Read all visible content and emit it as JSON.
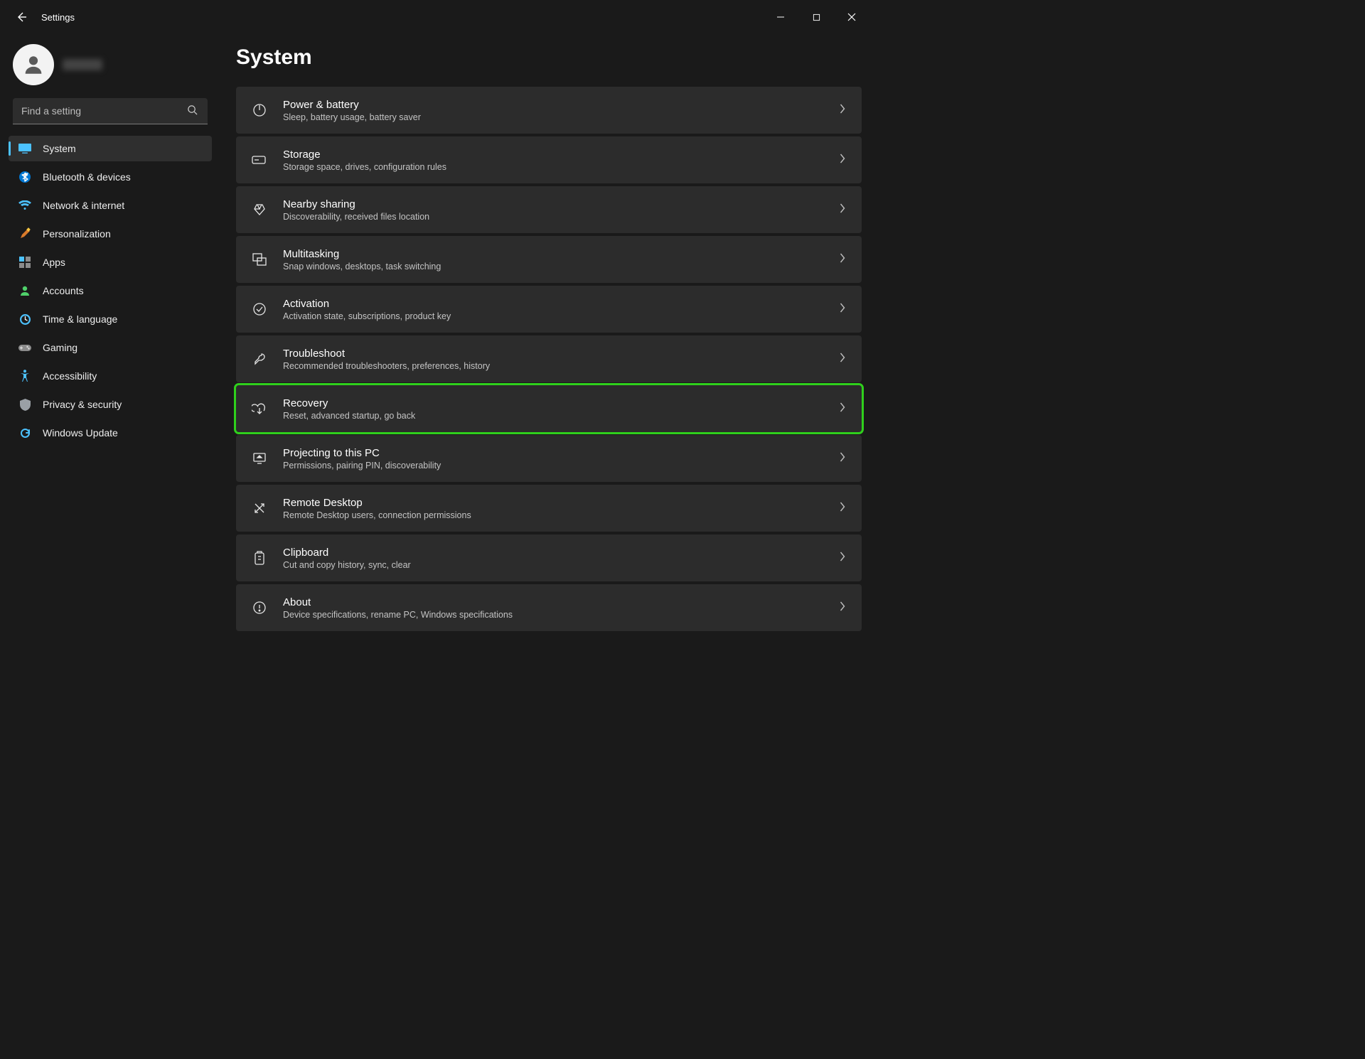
{
  "titlebar": {
    "app_title": "Settings"
  },
  "search": {
    "placeholder": "Find a setting"
  },
  "page": {
    "title": "System"
  },
  "sidebar": {
    "items": [
      {
        "label": "System"
      },
      {
        "label": "Bluetooth & devices"
      },
      {
        "label": "Network & internet"
      },
      {
        "label": "Personalization"
      },
      {
        "label": "Apps"
      },
      {
        "label": "Accounts"
      },
      {
        "label": "Time & language"
      },
      {
        "label": "Gaming"
      },
      {
        "label": "Accessibility"
      },
      {
        "label": "Privacy & security"
      },
      {
        "label": "Windows Update"
      }
    ]
  },
  "cards": [
    {
      "title": "Power & battery",
      "sub": "Sleep, battery usage, battery saver"
    },
    {
      "title": "Storage",
      "sub": "Storage space, drives, configuration rules"
    },
    {
      "title": "Nearby sharing",
      "sub": "Discoverability, received files location"
    },
    {
      "title": "Multitasking",
      "sub": "Snap windows, desktops, task switching"
    },
    {
      "title": "Activation",
      "sub": "Activation state, subscriptions, product key"
    },
    {
      "title": "Troubleshoot",
      "sub": "Recommended troubleshooters, preferences, history"
    },
    {
      "title": "Recovery",
      "sub": "Reset, advanced startup, go back"
    },
    {
      "title": "Projecting to this PC",
      "sub": "Permissions, pairing PIN, discoverability"
    },
    {
      "title": "Remote Desktop",
      "sub": "Remote Desktop users, connection permissions"
    },
    {
      "title": "Clipboard",
      "sub": "Cut and copy history, sync, clear"
    },
    {
      "title": "About",
      "sub": "Device specifications, rename PC, Windows specifications"
    }
  ],
  "highlight_index": 6
}
